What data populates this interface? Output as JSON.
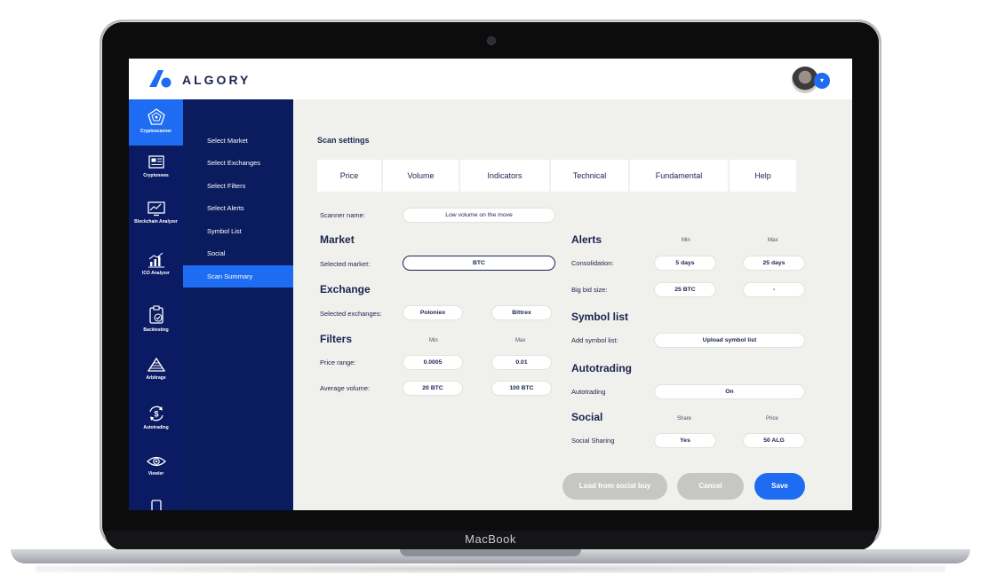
{
  "device": {
    "brand": "MacBook"
  },
  "header": {
    "logo_text": "ALGORY",
    "avatar_menu_icon": "chevron-down-icon"
  },
  "rail": {
    "items": [
      {
        "label": "Cryptoscanner",
        "icon": "radar-icon"
      },
      {
        "label": "Cryptonews",
        "icon": "newspaper-icon"
      },
      {
        "label": "Blockchain Analyzer",
        "icon": "chart-monitor-icon"
      },
      {
        "label": "ICO Analyzer",
        "icon": "bar-chart-icon"
      },
      {
        "label": "Backtesting",
        "icon": "clipboard-check-icon"
      },
      {
        "label": "Arbitrage",
        "icon": "pyramid-icon"
      },
      {
        "label": "Autotrading",
        "icon": "dollar-cycle-icon"
      },
      {
        "label": "Viewler",
        "icon": "eye-icon"
      }
    ],
    "active_color": "#1d6cf2"
  },
  "subnav": {
    "items": [
      "Select Market",
      "Select Exchanges",
      "Select Filters",
      "Select Alerts",
      "Symbol List",
      "Social",
      "Scan Summary"
    ]
  },
  "main": {
    "title": "Scan settings",
    "tabs": [
      "Price",
      "Volume",
      "Indicators",
      "Technical",
      "Fundamental",
      "Help"
    ],
    "scanner_name_label": "Scanner name:",
    "scanner_name_value": "Low volume on the move",
    "market": {
      "heading": "Market",
      "label": "Selected market:",
      "value": "BTC"
    },
    "exchange": {
      "heading": "Exchange",
      "label": "Selected exchanges:",
      "values": [
        "Poloniex",
        "Bittrex"
      ]
    },
    "filters": {
      "heading": "Filters",
      "min": "Min",
      "max": "Max",
      "price_label": "Price range:",
      "price_min": "0.0005",
      "price_max": "0.01",
      "volume_label": "Average volume:",
      "volume_min": "20 BTC",
      "volume_max": "100 BTC"
    },
    "alerts": {
      "heading": "Alerts",
      "min": "Min",
      "max": "Max",
      "consolidation_label": "Consolidation:",
      "consolidation_min": "5 days",
      "consolidation_max": "25 days",
      "bigbid_label": "Big bid size:",
      "bigbid_min": "25 BTC",
      "bigbid_max": "-"
    },
    "symbol_list": {
      "heading": "Symbol list",
      "label": "Add symbol list:",
      "button": "Upload symbol list"
    },
    "autotrading": {
      "heading": "Autotrading",
      "label": "Autotrading",
      "value": "On"
    },
    "social": {
      "heading": "Social",
      "share": "Share",
      "price": "Price",
      "label": "Social Sharing",
      "share_value": "Yes",
      "price_value": "50 ALG"
    },
    "buttons": {
      "load": "Load from social buy",
      "cancel": "Cancel",
      "save": "Save"
    }
  },
  "colors": {
    "primary": "#1d6cf2",
    "navy": "#0a1a63",
    "disabled": "#c6c6c4"
  }
}
